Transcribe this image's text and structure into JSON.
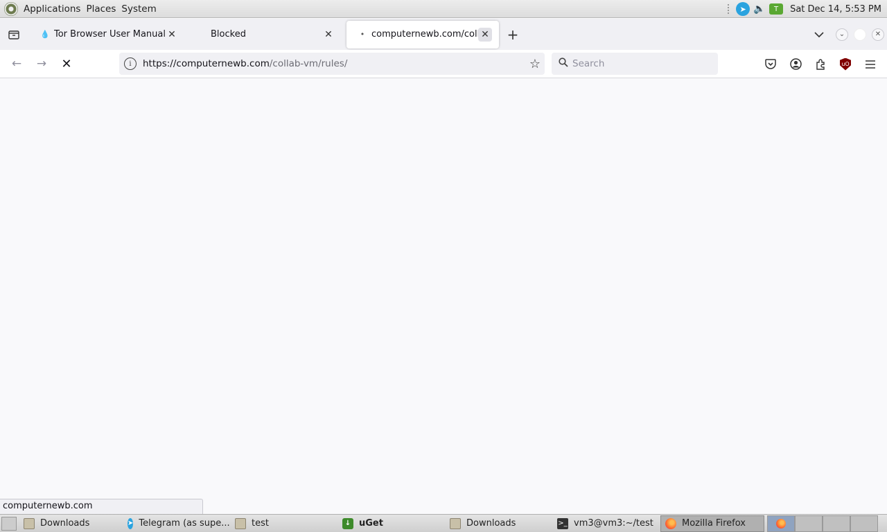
{
  "top_panel": {
    "menus": [
      "Applications",
      "Places",
      "System"
    ],
    "clock": "Sat Dec 14,  5:53 PM"
  },
  "tabs": [
    {
      "title": "Tor Browser User Manual | T",
      "active": false
    },
    {
      "title": "Blocked",
      "active": false
    },
    {
      "title": "computernewb.com/collab",
      "active": true
    }
  ],
  "navbar": {
    "url_host": "https://computernewb.com",
    "url_path": "/collab-vm/rules/",
    "search_placeholder": "Search"
  },
  "status_text": "computernewb.com",
  "taskbar": {
    "items": [
      {
        "label": "Downloads",
        "icon": "folder-icon"
      },
      {
        "label": "Telegram (as supe...",
        "icon": "telegram-icon"
      },
      {
        "label": "test",
        "icon": "folder-icon"
      },
      {
        "label": "uGet",
        "icon": "uget-icon"
      },
      {
        "label": "Downloads",
        "icon": "folder-icon"
      },
      {
        "label": "vm3@vm3:~/test",
        "icon": "terminal-icon"
      },
      {
        "label": "Mozilla Firefox",
        "icon": "firefox-icon"
      }
    ]
  }
}
